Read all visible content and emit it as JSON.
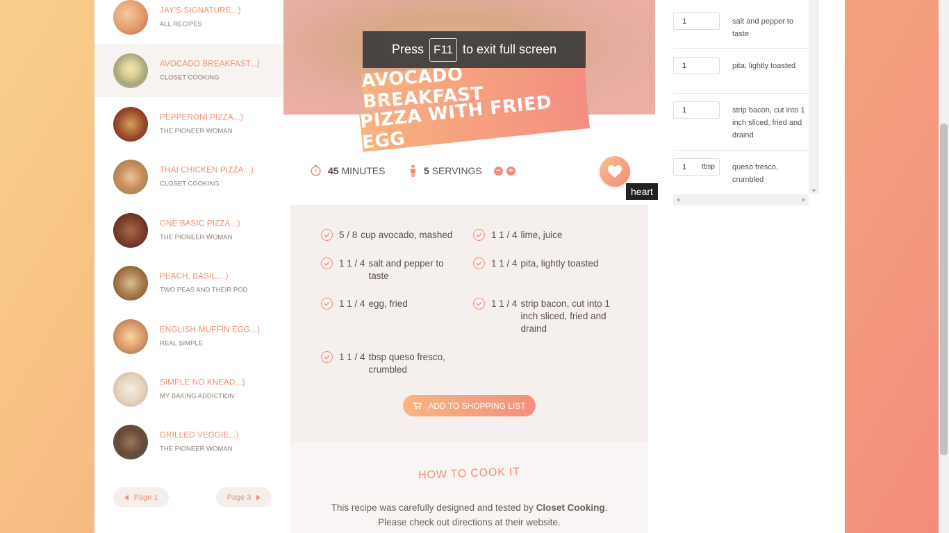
{
  "sidebar": {
    "recipes": [
      {
        "title": "JAY'S SIGNATURE...)",
        "source": "ALL RECIPES"
      },
      {
        "title": "AVOCADO BREAKFAST...)",
        "source": "CLOSET COOKING"
      },
      {
        "title": "PEPPERONI PIZZA...)",
        "source": "THE PIONEER WOMAN"
      },
      {
        "title": "THAI CHICKEN PIZZA...)",
        "source": "CLOSET COOKING"
      },
      {
        "title": "ONE BASIC PIZZA...)",
        "source": "THE PIONEER WOMAN"
      },
      {
        "title": "PEACH, BASIL,...)",
        "source": "TWO PEAS AND THEIR POD"
      },
      {
        "title": "ENGLISH-MUFFIN EGG...)",
        "source": "REAL SIMPLE"
      },
      {
        "title": "SIMPLE NO KNEAD...)",
        "source": "MY BAKING ADDICTION"
      },
      {
        "title": "GRILLED VEGGIE...)",
        "source": "THE PIONEER WOMAN"
      }
    ],
    "prev_page": "Page 1",
    "next_page": "Page 3"
  },
  "fullscreen_toast": {
    "press": "Press",
    "key": "F11",
    "rest": "to exit full screen"
  },
  "recipe": {
    "title_line1": "AVOCADO BREAKFAST",
    "title_line2": "PIZZA WITH FRIED EGG",
    "time_value": "45",
    "time_unit": "MINUTES",
    "servings_value": "5",
    "servings_unit": "SERVINGS",
    "heart_tooltip": "heart",
    "ingredients": [
      {
        "qty": "5 / 8",
        "name": "cup avocado, mashed"
      },
      {
        "qty": "1 1 / 4",
        "name": "lime, juice"
      },
      {
        "qty": "1 1 / 4",
        "name": "salt and pepper to taste"
      },
      {
        "qty": "1 1 / 4",
        "name": "pita, lightly toasted"
      },
      {
        "qty": "1 1 / 4",
        "name": "egg, fried"
      },
      {
        "qty": "1 1 / 4",
        "name": "strip bacon, cut into 1 inch sliced, fried and draind"
      },
      {
        "qty": "1 1 / 4",
        "name": "tbsp queso fresco, crumbled"
      }
    ],
    "add_button": "ADD TO SHOPPING LIST",
    "howto_title": "HOW TO COOK IT",
    "howto_pre": "This recipe was carefully designed and tested by",
    "howto_author": "Closet Cooking",
    "howto_post": ".",
    "howto_line2": "Please check out directions at their website."
  },
  "shopping_panel": {
    "rows": [
      {
        "qty": "1",
        "unit": "",
        "name": "salt and pepper to taste"
      },
      {
        "qty": "1",
        "unit": "",
        "name": "pita, lightly toasted"
      },
      {
        "qty": "1",
        "unit": "",
        "name": "strip bacon, cut into 1 inch sliced, fried and draind"
      },
      {
        "qty": "1",
        "unit": "tbsp",
        "name": "queso fresco, crumbled"
      }
    ]
  },
  "colors": {
    "accent": "#f28c73",
    "accent_light": "#f9b580",
    "muted_bg": "#f5f0ee"
  }
}
